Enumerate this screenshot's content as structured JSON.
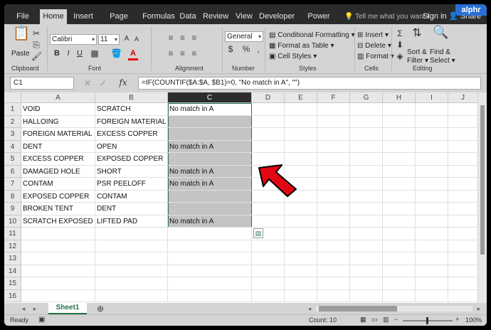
{
  "brand": {
    "logo_text": "alphr",
    "accent": "#217346",
    "logo_color": "#2a6fd6"
  },
  "tabs": [
    "File",
    "Home",
    "Insert",
    "Page Layout",
    "Formulas",
    "Data",
    "Review",
    "View",
    "Developer",
    "Power Pivot"
  ],
  "tell_me": "Tell me what you want t",
  "sign_in": "Sign in",
  "share": "Share",
  "ribbon": {
    "clipboard": {
      "label": "Clipboard",
      "paste": "Paste"
    },
    "font": {
      "label": "Font",
      "name": "Calibri",
      "size": "11",
      "bold": "B",
      "italic": "I",
      "underline": "U"
    },
    "alignment": {
      "label": "Alignment"
    },
    "number": {
      "label": "Number",
      "format": "General",
      "currency": "$",
      "percent": "%",
      "comma": ","
    },
    "styles": {
      "label": "Styles",
      "conditional": "Conditional Formatting",
      "format_table": "Format as Table",
      "cell_styles": "Cell Styles"
    },
    "cells": {
      "label": "Cells",
      "insert": "Insert",
      "delete": "Delete",
      "format": "Format"
    },
    "editing": {
      "label": "Editing",
      "sort": "Sort &",
      "filter": "Filter",
      "find": "Find &",
      "select": "Select"
    }
  },
  "formula_bar": {
    "name_box": "C1",
    "fx": "fx",
    "formula": "=IF(COUNTIF($A:$A, $B1)=0, \"No match in A\", \"\")"
  },
  "columns": [
    "A",
    "B",
    "C",
    "D",
    "E",
    "F",
    "G",
    "H",
    "I",
    "J"
  ],
  "rows": [
    "1",
    "2",
    "3",
    "4",
    "5",
    "6",
    "7",
    "8",
    "9",
    "10",
    "11",
    "12",
    "13",
    "14",
    "15",
    "16"
  ],
  "cells": {
    "A": [
      "VOID",
      "HALLOING",
      "FOREIGN MATERIAL",
      "DENT",
      "EXCESS COPPER",
      "DAMAGED HOLE",
      "CONTAM",
      "EXPOSED COPPER",
      "BROKEN TENT",
      "SCRATCH EXPOSED"
    ],
    "B": [
      "SCRATCH",
      "FOREIGN MATERIAL",
      "EXCESS COPPER",
      "OPEN",
      "EXPOSED COPPER",
      "SHORT",
      "PSR PEELOFF",
      "CONTAM",
      "DENT",
      "LIFTED PAD"
    ],
    "C": [
      "No match in A",
      "",
      "",
      "No match in A",
      "",
      "No match in A",
      "No match in A",
      "",
      "",
      "No match in A"
    ]
  },
  "sheet_tab": "Sheet1",
  "status": {
    "ready": "Ready",
    "count": "Count: 10",
    "zoom": "100%"
  }
}
